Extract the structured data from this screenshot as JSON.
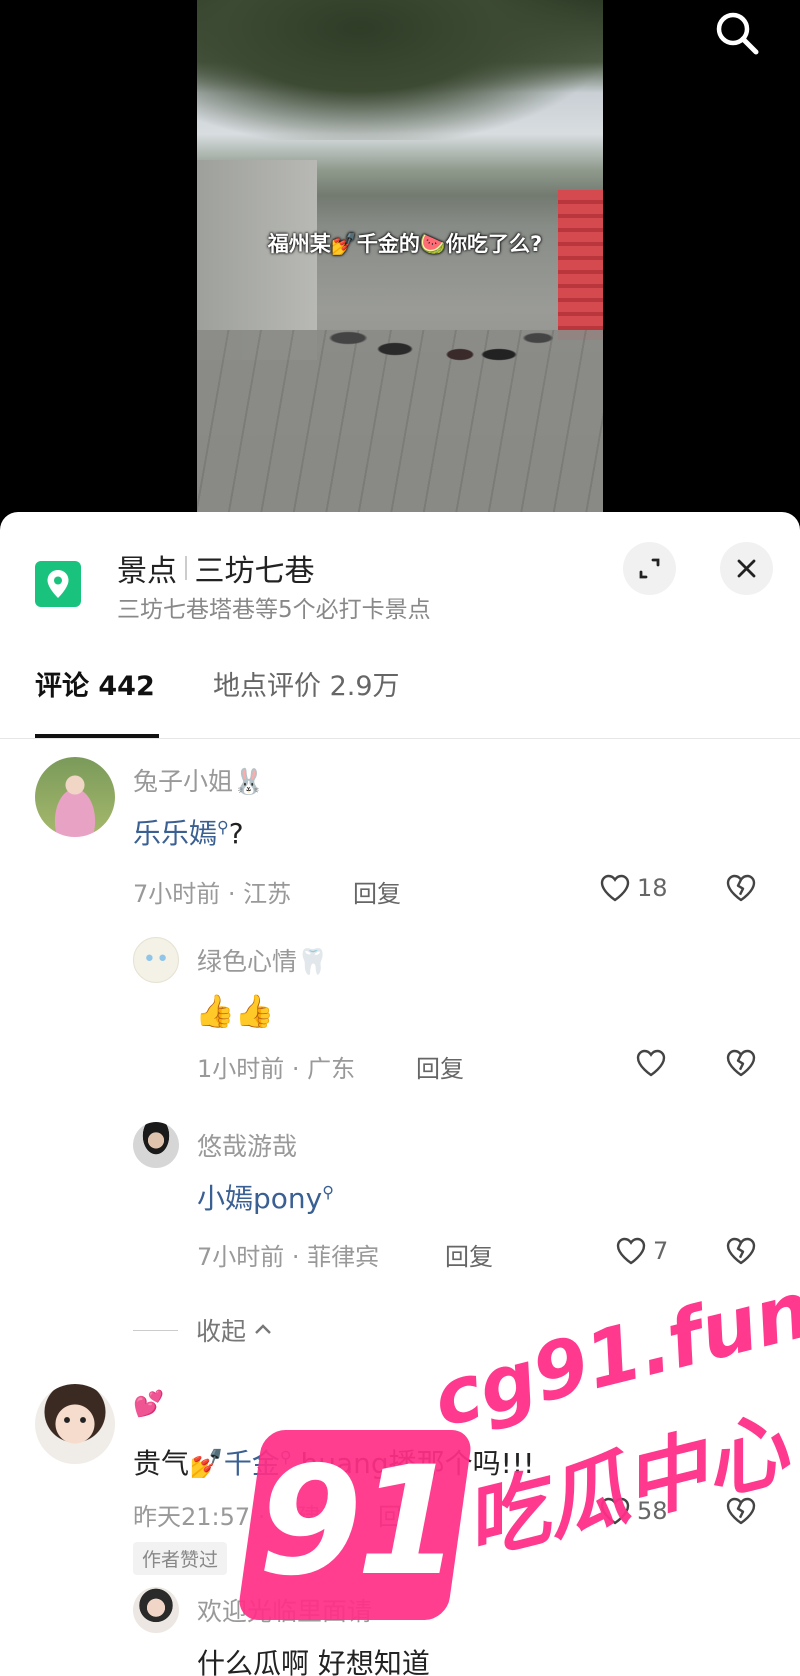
{
  "video": {
    "caption": "福州某💅千金的🍉你吃了么?"
  },
  "icons": {
    "search": "search-icon",
    "location": "location-pin-icon",
    "expand": "expand-icon",
    "close": "close-icon",
    "like": "heart-icon",
    "dislike": "broken-heart-icon",
    "collapse": "chevron-up-icon"
  },
  "location": {
    "category": "景点",
    "name": "三坊七巷",
    "subtitle": "三坊七巷塔巷等5个必打卡景点",
    "accent_color": "#19c37d"
  },
  "tabs": [
    {
      "label": "评论 442"
    },
    {
      "label": "地点评价 2.9万"
    }
  ],
  "comments": [
    {
      "user": "兔子小姐🐰",
      "text_link": "乐乐嫣",
      "text_rest": "?",
      "time": "7小时前 · 江苏",
      "reply_label": "回复",
      "likes": "18"
    },
    {
      "user": "绿色心情🦷",
      "text": "👍👍",
      "time": "1小时前 · 广东",
      "reply_label": "回复",
      "likes": ""
    },
    {
      "user": "悠哉游哉",
      "text_link": "小嫣pony",
      "time": "7小时前 · 菲律宾",
      "reply_label": "回复",
      "likes": "7"
    },
    {
      "user": "💕",
      "text_prefix": "贵气💅",
      "text_link": "千金",
      "text_rest": " huang播那个吗!!!",
      "time": "昨天21:57 · 福建",
      "reply_label": "回复",
      "likes": "58",
      "badge": "作者赞过"
    },
    {
      "user": "欢迎光临里面请",
      "text": "什么瓜啊 好想知道"
    }
  ],
  "collapse_label": "收起",
  "watermark": {
    "number": "91",
    "site": "cg91.fun",
    "text": "吃瓜中心"
  }
}
